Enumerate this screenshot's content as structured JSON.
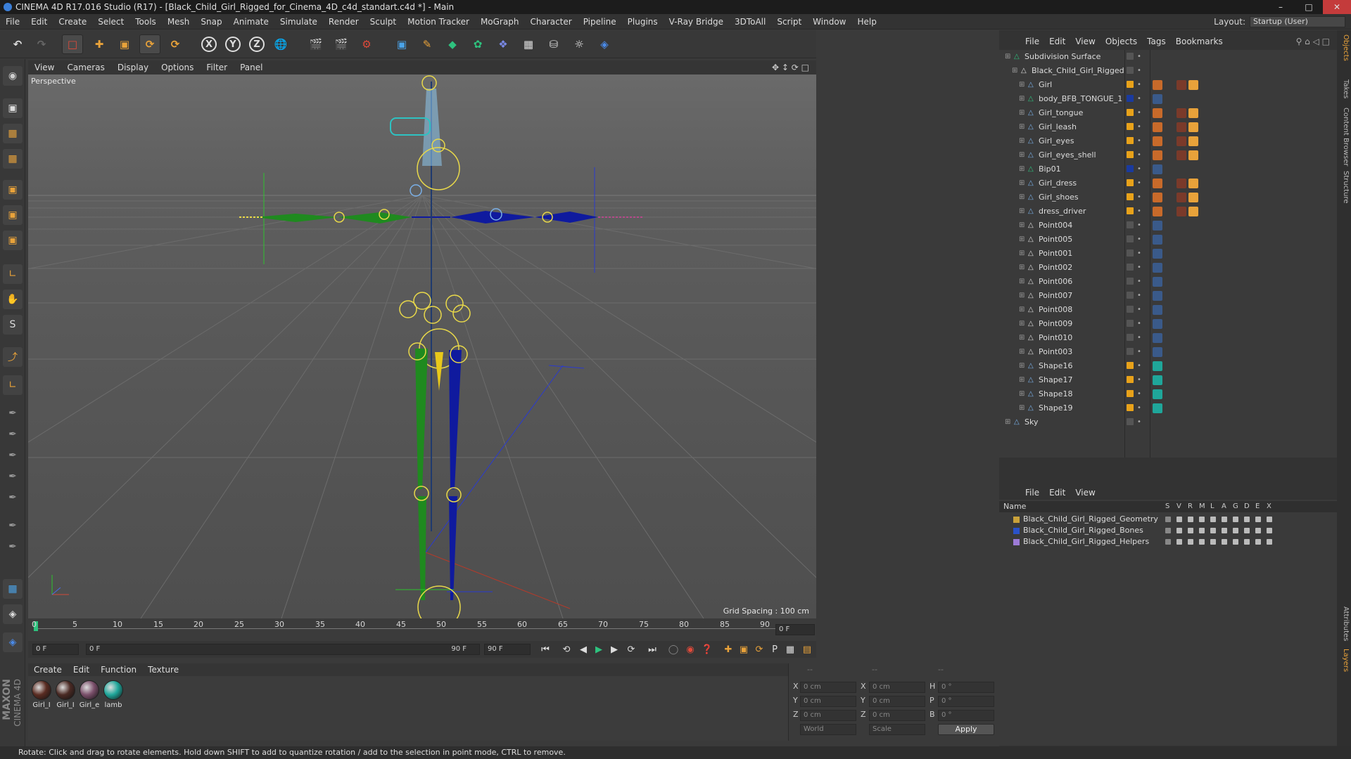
{
  "window": {
    "title": "CINEMA 4D R17.016 Studio (R17) - [Black_Child_Girl_Rigged_for_Cinema_4D_c4d_standart.c4d *] - Main"
  },
  "menu": [
    "File",
    "Edit",
    "Create",
    "Select",
    "Tools",
    "Mesh",
    "Snap",
    "Animate",
    "Simulate",
    "Render",
    "Sculpt",
    "Motion Tracker",
    "MoGraph",
    "Character",
    "Pipeline",
    "Plugins",
    "V-Ray Bridge",
    "3DToAll",
    "Script",
    "Window",
    "Help"
  ],
  "layout": {
    "label": "Layout:",
    "value": "Startup (User)"
  },
  "toolbar": {
    "x": "X",
    "y": "Y",
    "z": "Z"
  },
  "viewport": {
    "menu": [
      "View",
      "Cameras",
      "Display",
      "Options",
      "Filter",
      "Panel"
    ],
    "label": "Perspective",
    "grid_spacing": "Grid Spacing : 100 cm"
  },
  "timeline": {
    "ticks": [
      "0",
      "5",
      "10",
      "15",
      "20",
      "25",
      "30",
      "35",
      "40",
      "45",
      "50",
      "55",
      "60",
      "65",
      "70",
      "75",
      "80",
      "85",
      "90"
    ],
    "current_frame": "0 F",
    "start": "0 F",
    "slider_start": "0 F",
    "slider_end": "90 F",
    "end": "90 F",
    "frame_right": "0 F"
  },
  "materials": {
    "menu": [
      "Create",
      "Edit",
      "Function",
      "Texture"
    ],
    "items": [
      {
        "name": "Girl_I",
        "color": "#5a2c22"
      },
      {
        "name": "Girl_I",
        "color": "#4a2a24"
      },
      {
        "name": "Girl_e",
        "color": "#7a4f6a"
      },
      {
        "name": "lamb",
        "color": "#1fa69a"
      }
    ]
  },
  "coords": {
    "header": [
      "--",
      "--",
      "--"
    ],
    "rows": [
      {
        "a": "X",
        "av": "0 cm",
        "b": "X",
        "bv": "0 cm",
        "c": "H",
        "cv": "0 °"
      },
      {
        "a": "Y",
        "av": "0 cm",
        "b": "Y",
        "bv": "0 cm",
        "c": "P",
        "cv": "0 °"
      },
      {
        "a": "Z",
        "av": "0 cm",
        "b": "Z",
        "bv": "0 cm",
        "c": "B",
        "cv": "0 °"
      }
    ],
    "world": "World",
    "scale": "Scale",
    "apply": "Apply"
  },
  "status": "Rotate: Click and drag to rotate elements. Hold down SHIFT to add to quantize rotation / add to the selection in point mode, CTRL to remove.",
  "maxon": {
    "brand": "MAXON",
    "product": "CINEMA 4D"
  },
  "objects": {
    "menu": [
      "File",
      "Edit",
      "View",
      "Objects",
      "Tags",
      "Bookmarks"
    ],
    "rows": [
      {
        "name": "Subdivision Surface",
        "indent": 0,
        "color": "#2ec27e",
        "vis": "#555555"
      },
      {
        "name": "Black_Child_Girl_Rigged",
        "indent": 1,
        "color": "#dddddd",
        "vis": "#555555"
      },
      {
        "name": "Girl",
        "indent": 2,
        "color": "#7ab0e8",
        "vis": "#e8a21a"
      },
      {
        "name": "body_BFB_TONGUE_1",
        "indent": 2,
        "color": "#2ec27e",
        "vis": "#1a3a9e"
      },
      {
        "name": "Girl_tongue",
        "indent": 2,
        "color": "#7ab0e8",
        "vis": "#e8a21a"
      },
      {
        "name": "Girl_leash",
        "indent": 2,
        "color": "#7ab0e8",
        "vis": "#e8a21a"
      },
      {
        "name": "Girl_eyes",
        "indent": 2,
        "color": "#7ab0e8",
        "vis": "#e8a21a"
      },
      {
        "name": "Girl_eyes_shell",
        "indent": 2,
        "color": "#7ab0e8",
        "vis": "#e8a21a"
      },
      {
        "name": "Bip01",
        "indent": 2,
        "color": "#2ec27e",
        "vis": "#1a3a9e"
      },
      {
        "name": "Girl_dress",
        "indent": 2,
        "color": "#7ab0e8",
        "vis": "#e8a21a"
      },
      {
        "name": "Girl_shoes",
        "indent": 2,
        "color": "#7ab0e8",
        "vis": "#e8a21a"
      },
      {
        "name": "dress_driver",
        "indent": 2,
        "color": "#7ab0e8",
        "vis": "#e8a21a"
      },
      {
        "name": "Point004",
        "indent": 2,
        "color": "#dddddd",
        "vis": "#555555"
      },
      {
        "name": "Point005",
        "indent": 2,
        "color": "#dddddd",
        "vis": "#555555"
      },
      {
        "name": "Point001",
        "indent": 2,
        "color": "#dddddd",
        "vis": "#555555"
      },
      {
        "name": "Point002",
        "indent": 2,
        "color": "#dddddd",
        "vis": "#555555"
      },
      {
        "name": "Point006",
        "indent": 2,
        "color": "#dddddd",
        "vis": "#555555"
      },
      {
        "name": "Point007",
        "indent": 2,
        "color": "#dddddd",
        "vis": "#555555"
      },
      {
        "name": "Point008",
        "indent": 2,
        "color": "#dddddd",
        "vis": "#555555"
      },
      {
        "name": "Point009",
        "indent": 2,
        "color": "#dddddd",
        "vis": "#555555"
      },
      {
        "name": "Point010",
        "indent": 2,
        "color": "#dddddd",
        "vis": "#555555"
      },
      {
        "name": "Point003",
        "indent": 2,
        "color": "#dddddd",
        "vis": "#555555"
      },
      {
        "name": "Shape16",
        "indent": 2,
        "color": "#7ab0e8",
        "vis": "#e8a21a"
      },
      {
        "name": "Shape17",
        "indent": 2,
        "color": "#7ab0e8",
        "vis": "#e8a21a"
      },
      {
        "name": "Shape18",
        "indent": 2,
        "color": "#7ab0e8",
        "vis": "#e8a21a"
      },
      {
        "name": "Shape19",
        "indent": 2,
        "color": "#7ab0e8",
        "vis": "#e8a21a"
      },
      {
        "name": "Sky",
        "indent": 0,
        "color": "#7ab0e8",
        "vis": "#555555"
      }
    ]
  },
  "layers": {
    "menu": [
      "File",
      "Edit",
      "View"
    ],
    "head": {
      "name": "Name",
      "cols": [
        "S",
        "V",
        "R",
        "M",
        "L",
        "A",
        "G",
        "D",
        "E",
        "X"
      ]
    },
    "rows": [
      {
        "name": "Black_Child_Girl_Rigged_Geometry",
        "color": "#c9a13a"
      },
      {
        "name": "Black_Child_Girl_Rigged_Bones",
        "color": "#2a52c9"
      },
      {
        "name": "Black_Child_Girl_Rigged_Helpers",
        "color": "#9c7ad6"
      }
    ]
  },
  "side_tabs": [
    "Objects",
    "Takes",
    "Content Browser",
    "Structure",
    "Attributes",
    "Layers"
  ],
  "colors": {
    "accent": "#e8a23a",
    "bone_green": "#1f8a1f",
    "bone_blue": "#0f1a9e",
    "helper_yellow": "#e8d84a"
  }
}
